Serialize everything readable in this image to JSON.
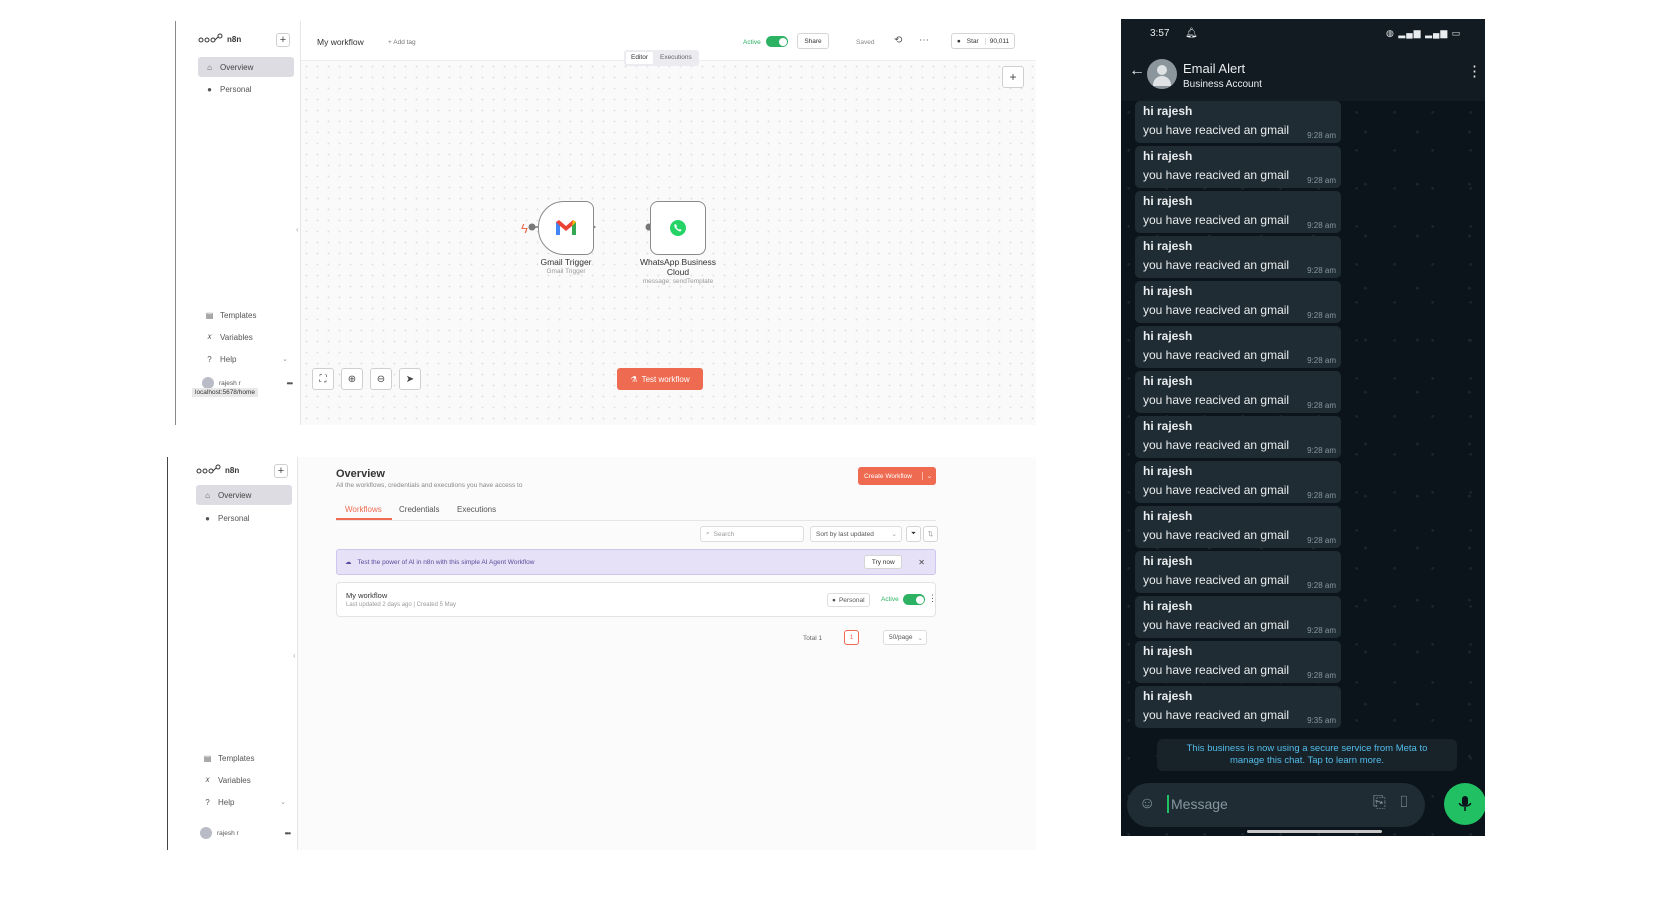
{
  "editor": {
    "brand": "n8n",
    "nav": [
      "Overview",
      "Personal"
    ],
    "bottom_nav": [
      "Templates",
      "Variables",
      "Help"
    ],
    "user": "rajesh r",
    "status_url": "localhost:5678/home",
    "workflow_title": "My workflow",
    "add_tag": "+ Add tag",
    "active_label": "Active",
    "share_label": "Share",
    "saved_label": "Saved",
    "star_label": "Star",
    "star_count": "90,011",
    "view_tabs": [
      "Editor",
      "Executions"
    ],
    "nodes": [
      {
        "title": "Gmail Trigger",
        "subtitle": "Gmail Trigger"
      },
      {
        "title_line1": "WhatsApp Business",
        "title_line2": "Cloud",
        "subtitle": "message: sendTemplate"
      }
    ],
    "test_button": "Test workflow"
  },
  "overview": {
    "brand": "n8n",
    "nav": [
      "Overview",
      "Personal"
    ],
    "bottom_nav": [
      "Templates",
      "Variables",
      "Help"
    ],
    "user": "rajesh r",
    "title": "Overview",
    "subtitle": "All the workflows, credentials and executions you have access to",
    "create_button": "Create Workflow",
    "tabs": [
      "Workflows",
      "Credentials",
      "Executions"
    ],
    "search_placeholder": "Search",
    "sort_label": "Sort by last updated",
    "banner_text": "Test the power of AI in n8n with this simple AI Agent Workflow",
    "try_now": "Try now",
    "workflow": {
      "name": "My workflow",
      "meta": "Last updated 2 days ago | Created 5 May",
      "owner": "Personal",
      "active_label": "Active"
    },
    "total": "Total 1",
    "page": "1",
    "page_size": "50/page"
  },
  "whatsapp": {
    "time": "3:57",
    "contact": "Email Alert",
    "account_type": "Business Account",
    "messages": [
      {
        "who": "hi rajesh",
        "text": "you have reacived an gmail",
        "time": "9:28 am"
      },
      {
        "who": "hi rajesh",
        "text": "you have reacived an gmail",
        "time": "9:28 am"
      },
      {
        "who": "hi rajesh",
        "text": "you have reacived an gmail",
        "time": "9:28 am"
      },
      {
        "who": "hi rajesh",
        "text": "you have reacived an gmail",
        "time": "9:28 am"
      },
      {
        "who": "hi rajesh",
        "text": "you have reacived an gmail",
        "time": "9:28 am"
      },
      {
        "who": "hi rajesh",
        "text": "you have reacived an gmail",
        "time": "9:28 am"
      },
      {
        "who": "hi rajesh",
        "text": "you have reacived an gmail",
        "time": "9:28 am"
      },
      {
        "who": "hi rajesh",
        "text": "you have reacived an gmail",
        "time": "9:28 am"
      },
      {
        "who": "hi rajesh",
        "text": "you have reacived an gmail",
        "time": "9:28 am"
      },
      {
        "who": "hi rajesh",
        "text": "you have reacived an gmail",
        "time": "9:28 am"
      },
      {
        "who": "hi rajesh",
        "text": "you have reacived an gmail",
        "time": "9:28 am"
      },
      {
        "who": "hi rajesh",
        "text": "you have reacived an gmail",
        "time": "9:28 am"
      },
      {
        "who": "hi rajesh",
        "text": "you have reacived an gmail",
        "time": "9:28 am"
      },
      {
        "who": "hi rajesh",
        "text": "you have reacived an gmail",
        "time": "9:35 am"
      }
    ],
    "notice_line1": "This business is now using a secure service from Meta to",
    "notice_line2": "manage this chat. Tap to learn more.",
    "input_placeholder": "Message",
    "accent": "#21c063"
  },
  "colors": {
    "n8n_accent": "#ee6b51",
    "active_green": "#2db264",
    "banner_bg": "#e6e1f7"
  }
}
